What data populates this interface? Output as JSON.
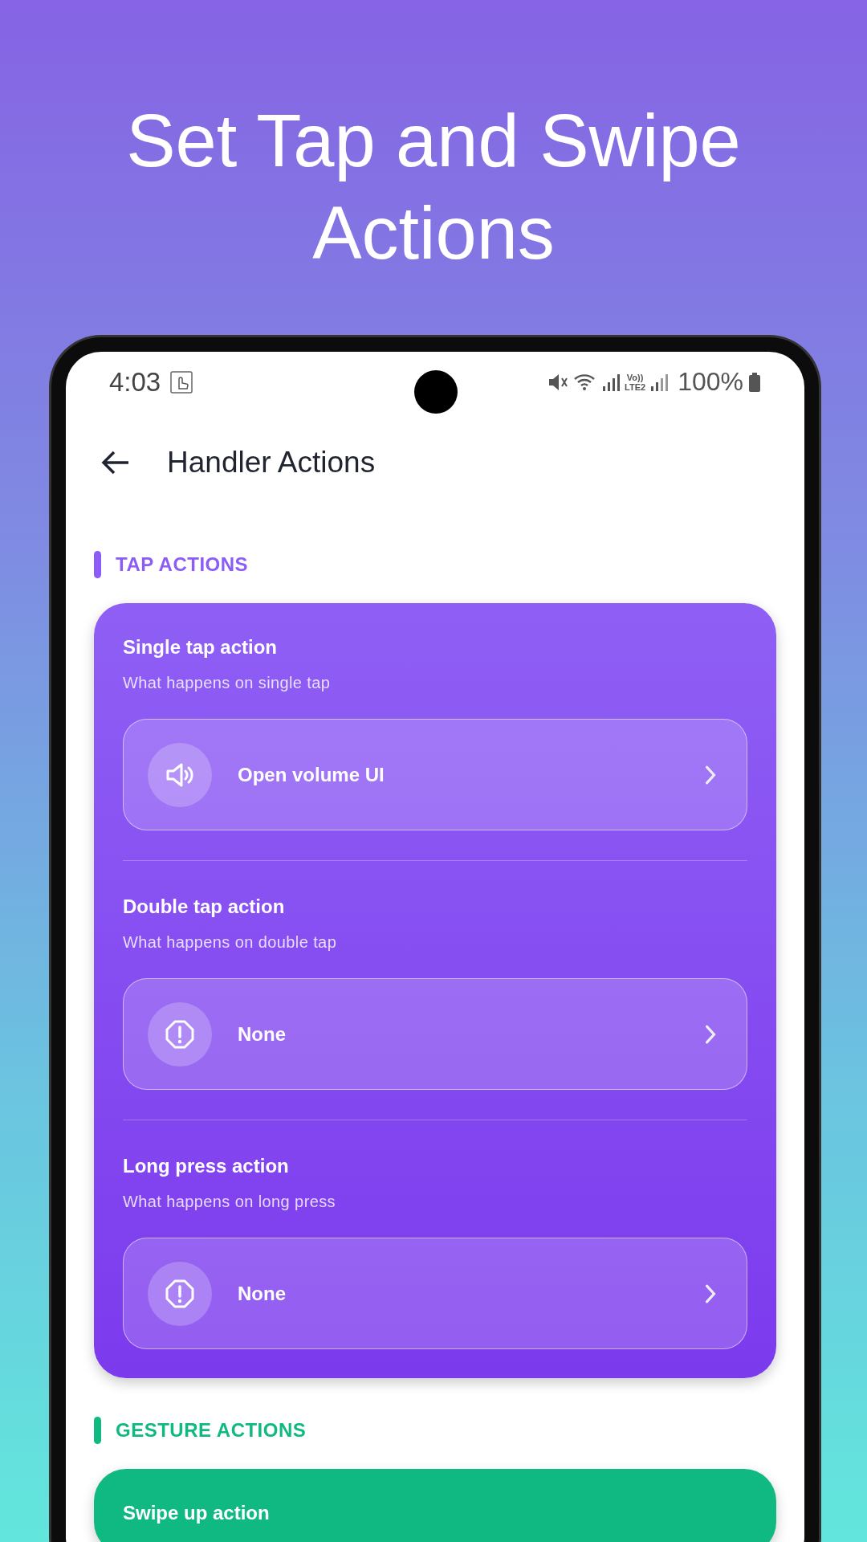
{
  "headline": "Set Tap and Swipe Actions",
  "status_bar": {
    "time": "4:03",
    "volte": "Vo))",
    "network": "LTE2",
    "battery": "100%"
  },
  "app_bar": {
    "title": "Handler Actions"
  },
  "sections": [
    {
      "title": "TAP ACTIONS",
      "color": "#8b5cf6",
      "items": [
        {
          "title": "Single tap action",
          "subtitle": "What happens on single tap",
          "value": "Open volume UI",
          "kind": "speaker"
        },
        {
          "title": "Double tap action",
          "subtitle": "What happens on double tap",
          "value": "None",
          "kind": "alert"
        },
        {
          "title": "Long press action",
          "subtitle": "What happens on long press",
          "value": "None",
          "kind": "alert"
        }
      ]
    },
    {
      "title": "GESTURE ACTIONS",
      "color": "#10b981",
      "items": [
        {
          "title": "Swipe up action"
        }
      ]
    }
  ]
}
